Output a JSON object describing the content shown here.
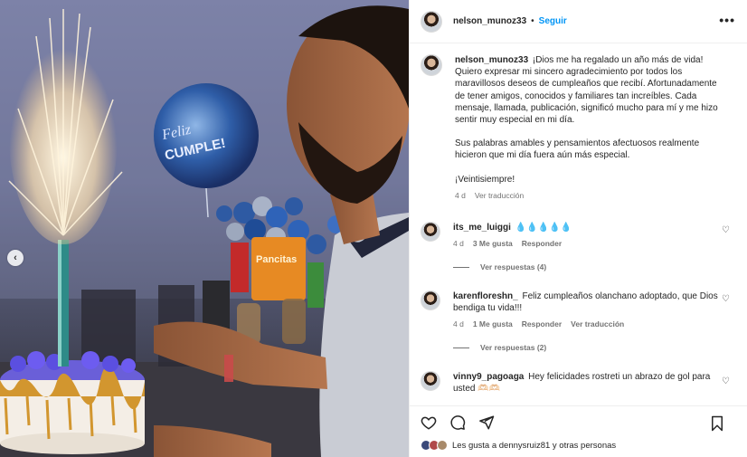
{
  "post": {
    "author": "nelson_munoz33",
    "separator": "•",
    "follow_label": "Seguir",
    "more_label": "•••",
    "caption_paragraphs": [
      "¡Dios me ha regalado un año más de vida! Quiero expresar mi sincero agradecimiento por todos los maravillosos deseos de cumpleaños que recibí. Afortunadamente de tener amigos, conocidos y familiares tan increíbles. Cada mensaje, llamada, publicación, significó mucho para mí y me hizo sentir muy especial en mi día.",
      "Sus palabras amables y pensamientos afectuosos realmente hicieron que mi día fuera aún más especial.",
      "¡Veintisiempre!"
    ],
    "caption_age": "4 d",
    "caption_translate": "Ver traducción",
    "likes_text": "Les gusta a dennysruiz81 y otras personas"
  },
  "comments": [
    {
      "user": "its_me_luiggi",
      "text": "💧💧💧💧💧",
      "age": "4 d",
      "likes": "3 Me gusta",
      "reply": "Responder",
      "translate": "",
      "replies": "Ver respuestas (4)"
    },
    {
      "user": "karenfloreshn_",
      "text": "Feliz cumpleaños olanchano adoptado, que Dios bendiga tu vida!!!",
      "age": "4 d",
      "likes": "1 Me gusta",
      "reply": "Responder",
      "translate": "Ver traducción",
      "replies": "Ver respuestas (2)"
    },
    {
      "user": "vinny9_pagoaga",
      "text": "Hey felicidades rostreti un abrazo de gol para usted 🫶🏻🫶🏻",
      "age": "",
      "likes": "",
      "reply": "",
      "translate": "",
      "replies": ""
    }
  ],
  "photo": {
    "balloon_text_line1": "Feliz",
    "balloon_text_line2": "CUMPLE!",
    "snack_text": "Pancitas"
  },
  "icons": {
    "carousel_prev": "‹",
    "heart_small": "♡"
  },
  "colors": {
    "accent": "#0095f6",
    "muted": "#737373",
    "text": "#262626"
  }
}
